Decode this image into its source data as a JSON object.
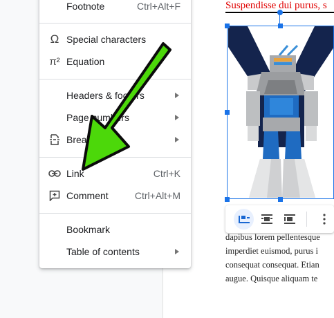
{
  "menu": {
    "footnote": {
      "label": "Footnote",
      "shortcut": "Ctrl+Alt+F"
    },
    "special_characters": {
      "label": "Special characters",
      "icon": "omega-icon"
    },
    "equation": {
      "label": "Equation",
      "icon": "pi-icon"
    },
    "headers_footers": {
      "label": "Headers & footers"
    },
    "page_numbers": {
      "label": "Page numbers"
    },
    "break": {
      "label": "Break",
      "icon": "page-break-icon"
    },
    "link": {
      "label": "Link",
      "shortcut": "Ctrl+K",
      "icon": "link-icon"
    },
    "comment": {
      "label": "Comment",
      "shortcut": "Ctrl+Alt+M",
      "icon": "add-comment-icon"
    },
    "bookmark": {
      "label": "Bookmark"
    },
    "table_of_contents": {
      "label": "Table of contents"
    }
  },
  "icons": {
    "omega": "Ω",
    "pi": "π²"
  },
  "document": {
    "red_heading": "Suspendisse dui purus, s",
    "body_lines": [
      "dapibus lorem pellentesque",
      "imperdiet euismod, purus i",
      "consequat consequat. Etian",
      "augue. Quisque aliquam te"
    ]
  },
  "colors": {
    "selection": "#1a73e8",
    "annotation_arrow": "#4cd80a",
    "heading_red": "#e00000"
  }
}
